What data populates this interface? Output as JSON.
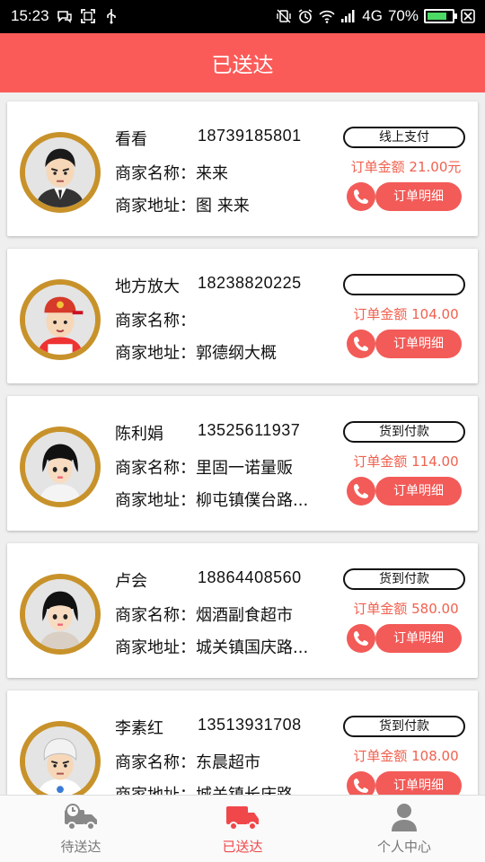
{
  "status_bar": {
    "time": "15:23",
    "network": "4G",
    "battery": "70%"
  },
  "header": {
    "title": "已送达"
  },
  "orders": [
    {
      "name": "看看",
      "phone": "18739185801",
      "shop_label": "商家名称：",
      "shop_name": "来来",
      "addr_label": "商家地址：",
      "address": "图 来来",
      "payment": "线上支付",
      "amount_label": "订单金额",
      "amount": "21.00元",
      "detail_label": "订单明细",
      "avatar": "man-suit"
    },
    {
      "name": "地方放大",
      "phone": "18238820225",
      "shop_label": "商家名称：",
      "shop_name": "",
      "addr_label": "商家地址：",
      "address": "郭德纲大概",
      "payment": "",
      "amount_label": "订单金额",
      "amount": "104.00",
      "detail_label": "订单明细",
      "avatar": "boy-cap"
    },
    {
      "name": "陈利娟",
      "phone": "13525611937",
      "shop_label": "商家名称：",
      "shop_name": "里固一诺量贩",
      "addr_label": "商家地址：",
      "address": "柳屯镇僕台路...",
      "payment": "货到付款",
      "amount_label": "订单金额",
      "amount": "114.00",
      "detail_label": "订单明细",
      "avatar": "woman"
    },
    {
      "name": "卢会",
      "phone": "18864408560",
      "shop_label": "商家名称：",
      "shop_name": "烟酒副食超市",
      "addr_label": "商家地址：",
      "address": "城关镇国庆路...",
      "payment": "货到付款",
      "amount_label": "订单金额",
      "amount": "580.00",
      "detail_label": "订单明细",
      "avatar": "woman"
    },
    {
      "name": "李素红",
      "phone": "13513931708",
      "shop_label": "商家名称：",
      "shop_name": "东晨超市",
      "addr_label": "商家地址：",
      "address": "城关镇长庆路...",
      "payment": "货到付款",
      "amount_label": "订单金额",
      "amount": "108.00",
      "detail_label": "订单明细",
      "avatar": "chef"
    }
  ],
  "bottom_nav": [
    {
      "label": "待送达",
      "icon": "pending-delivery-truck-icon",
      "active": false
    },
    {
      "label": "已送达",
      "icon": "delivered-truck-icon",
      "active": true
    },
    {
      "label": "个人中心",
      "icon": "profile-icon",
      "active": false
    }
  ],
  "colors": {
    "accent": "#fb5b58",
    "amount_text": "#f0614f",
    "avatar_ring": "#c8922b"
  }
}
